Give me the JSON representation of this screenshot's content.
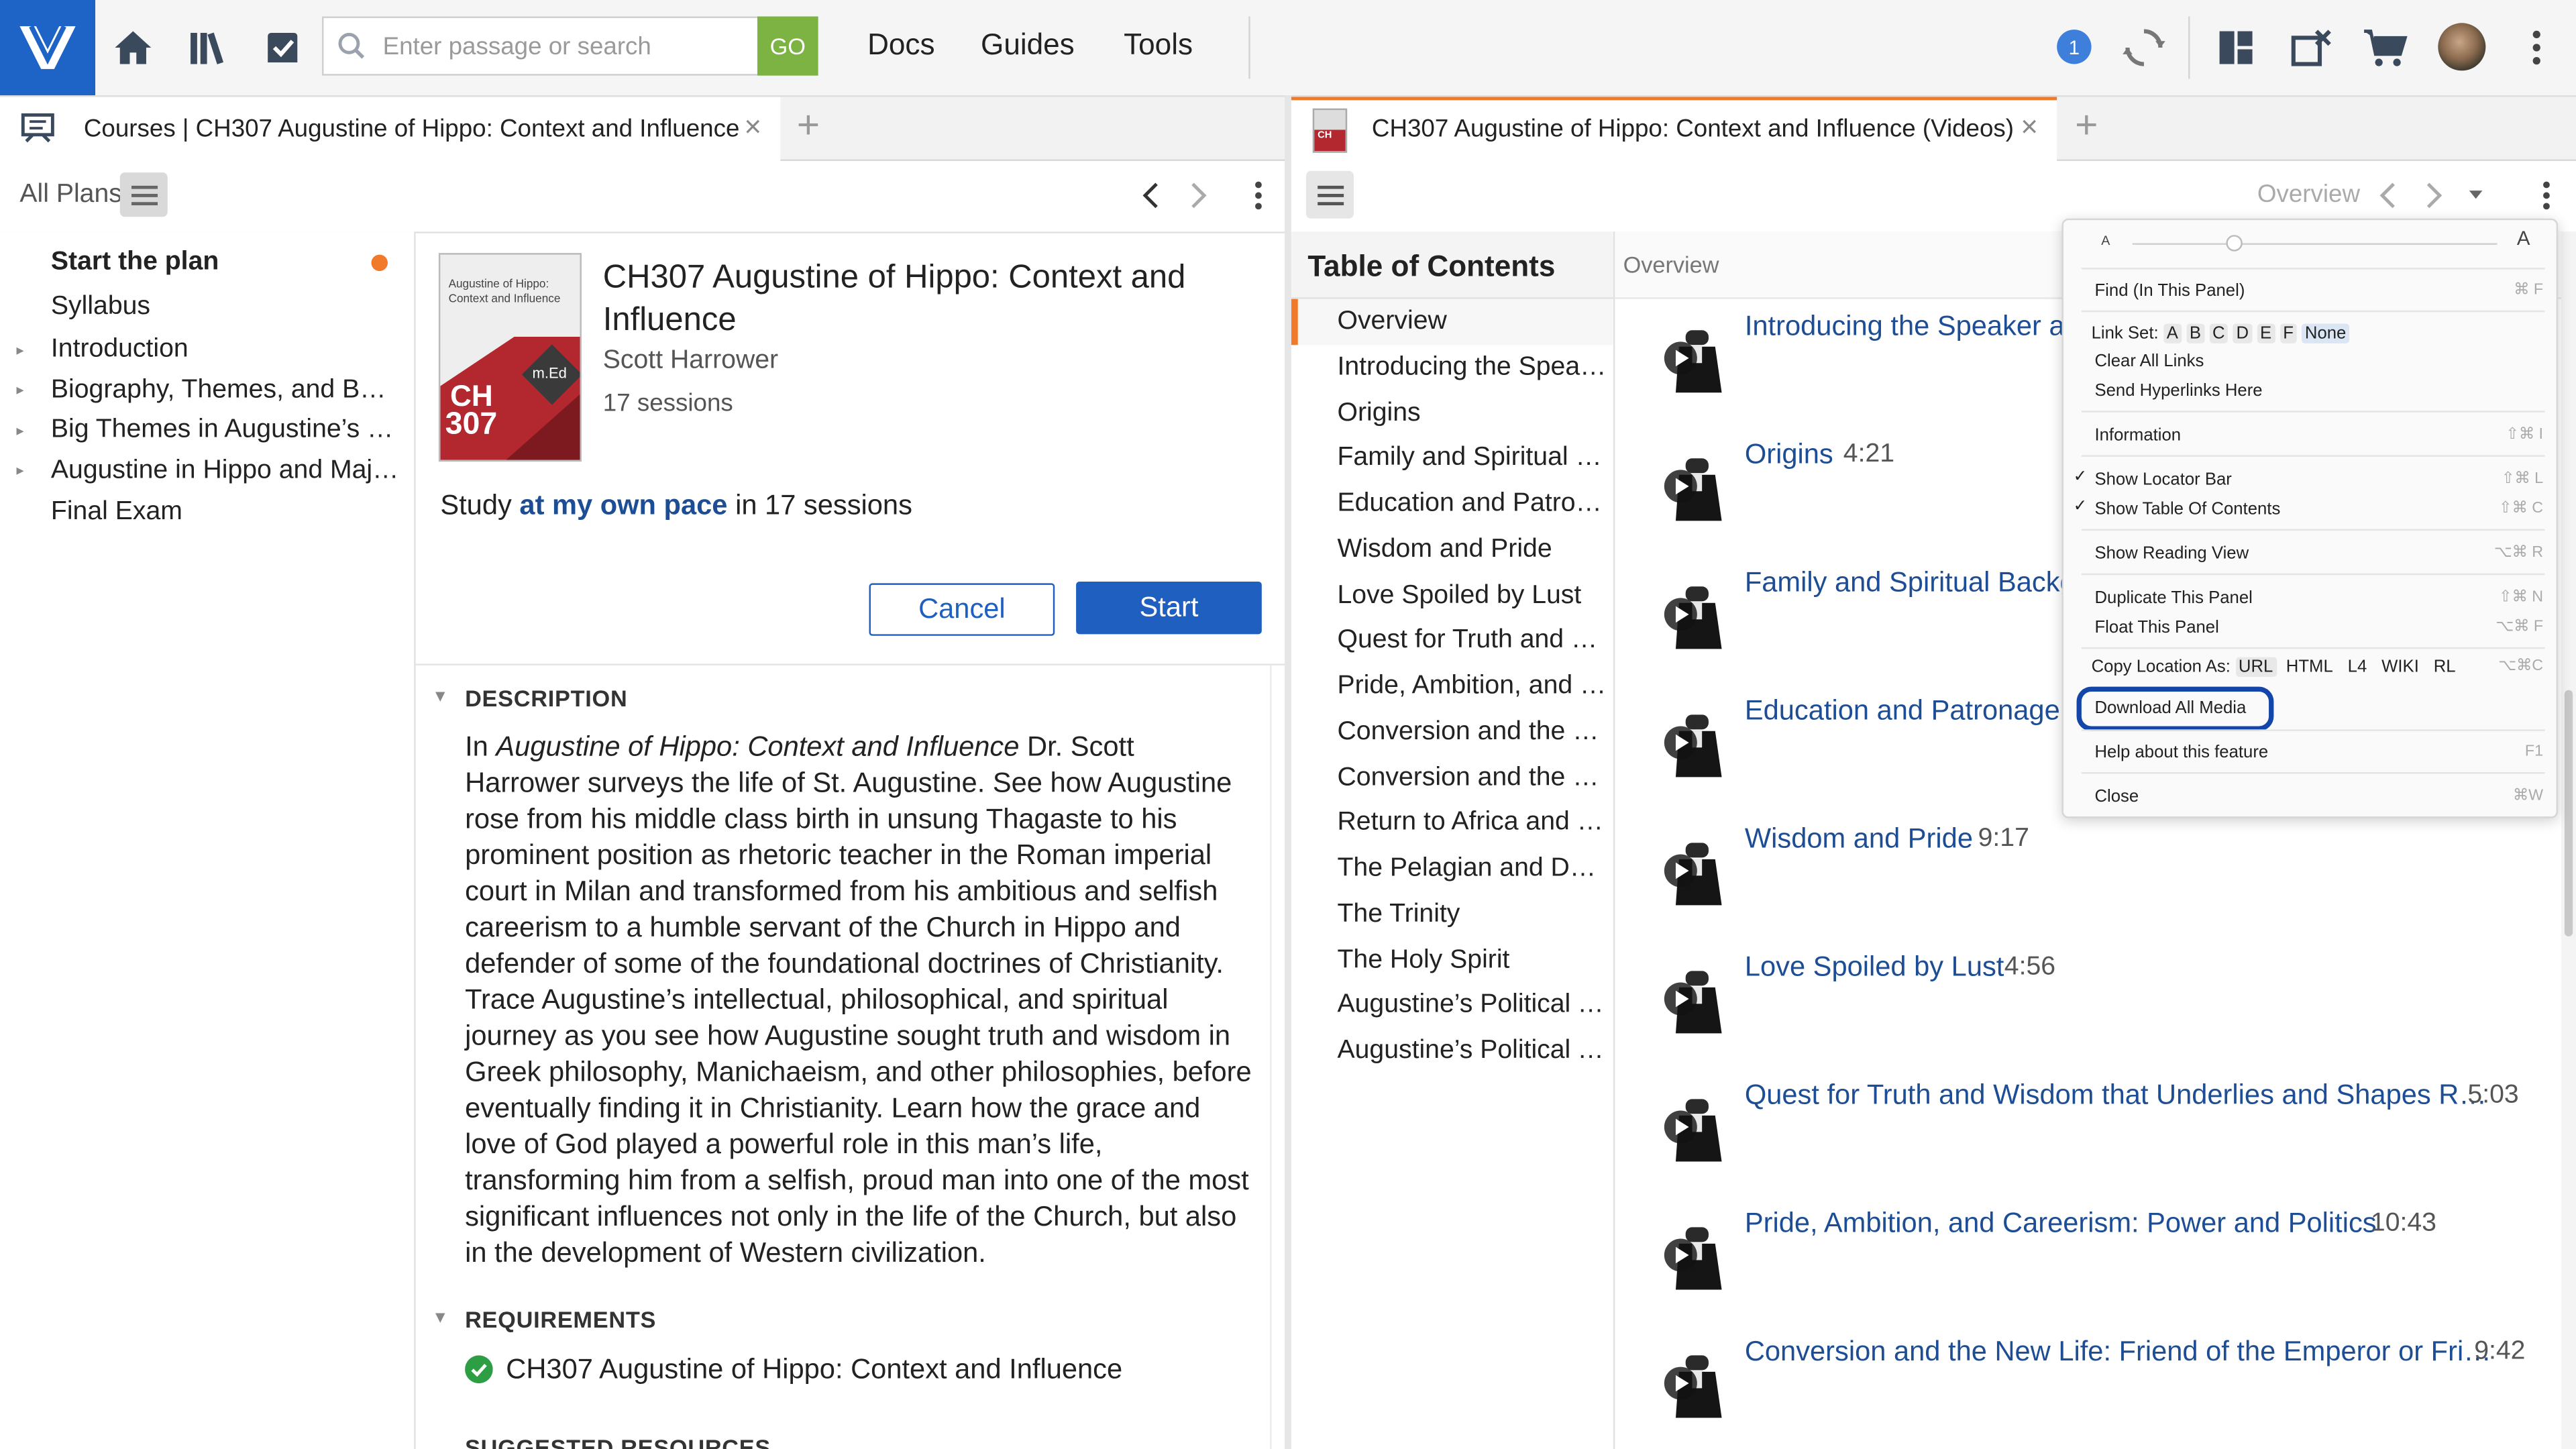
{
  "topbar": {
    "search_placeholder": "Enter passage or search",
    "go_label": "GO",
    "menu": [
      "Docs",
      "Guides",
      "Tools"
    ],
    "notification_count": "1"
  },
  "left_tab": {
    "title": "Courses | CH307 Augustine of Hippo: Context and Influence",
    "close": "×",
    "plus": "+"
  },
  "left_toolbar": {
    "all_plans": "All Plans"
  },
  "plan_sidebar": {
    "start": "Start the plan",
    "items": [
      "Syllabus",
      "Introduction",
      "Biography, Themes, and Background",
      "Big Themes in Augustine’s Life",
      "Augustine in Hippo and Major Works",
      "Final Exam"
    ],
    "carets": [
      "▸",
      "▸",
      "▸",
      "▸"
    ]
  },
  "course": {
    "title": "CH307 Augustine of Hippo: Context and Influence",
    "author": "Scott Harrower",
    "sessions": "17 sessions",
    "cover_caption": "Augustine of Hippo: Context and Influence",
    "cover_code_1": "CH",
    "cover_code_2": "307",
    "cover_badge": "m.Ed",
    "study_pre": "Study",
    "study_link": "at my own pace",
    "study_post": "in 17 sessions",
    "cancel": "Cancel",
    "start": "Start"
  },
  "description": {
    "heading": "DESCRIPTION",
    "pre": "In",
    "italic": "Augustine of Hippo: Context and Influence",
    "body": "Dr. Scott Harrower surveys the life of St. Augustine. See how Augustine rose from his middle class birth in unsung Thagaste to his prominent position as rhetoric teacher in the Roman imperial court in Milan and transformed from his ambitious and selfish careerism to a humble servant of the Church in Hippo and defender of some of the foundational doctrines of Christianity. Trace Augustine’s intellectual, philosophical, and spiritual journey as you see how Augustine sought truth and wisdom in Greek philosophy, Manichaeism, and other philosophies, before eventually finding it in Christianity. Learn how the grace and love of God played a powerful role in this man’s life, transforming him from a selfish, proud man into one of the most significant influences not only in the life of the Church, but also in the development of Western civilization."
  },
  "requirements": {
    "heading": "REQUIREMENTS",
    "item": "CH307 Augustine of Hippo: Context and Influence",
    "next_heading": "SUGGESTED RESOURCES"
  },
  "right_tab": {
    "title": "CH307 Augustine of Hippo: Context and Influence (Videos)",
    "close": "×",
    "plus": "+",
    "icon_code": "CH"
  },
  "right_toolbar": {
    "overview": "Overview"
  },
  "toc": {
    "heading": "Table of Contents",
    "items": [
      "Overview",
      "Introducing the Speaker and the Course",
      "Origins",
      "Family and Spiritual Background",
      "Education and Patronage",
      "Wisdom and Pride",
      "Love Spoiled by Lust",
      "Quest for Truth and Wisdom",
      "Pride, Ambition, and Careerism",
      "Conversion and the New Life",
      "Conversion and the New Life",
      "Return to Africa and the Church",
      "The Pelagian and Donatist Controversies",
      "The Trinity",
      "The Holy Spirit",
      "Augustine’s Political Theology",
      "Augustine’s Political Theology"
    ]
  },
  "content": {
    "breadcrumb": "Overview",
    "videos": [
      {
        "title": "Introducing the Speaker and the Course",
        "time": ""
      },
      {
        "title": "Origins",
        "time": "4:21"
      },
      {
        "title": "Family and Spiritual Background",
        "time": ""
      },
      {
        "title": "Education and Patronage",
        "time": ""
      },
      {
        "title": "Wisdom and Pride",
        "time": "9:17"
      },
      {
        "title": "Love Spoiled by Lust",
        "time": "4:56"
      },
      {
        "title": "Quest for Truth and Wisdom that Underlies and Shapes R…",
        "time": "5:03"
      },
      {
        "title": "Pride, Ambition, and Careerism: Power and Politics",
        "time": "10:43"
      },
      {
        "title": "Conversion and the New Life: Friend of the Emperor or Fri…",
        "time": "9:42"
      }
    ]
  },
  "panel_menu": {
    "font_small": "A",
    "font_large": "A",
    "find": "Find (In This Panel)",
    "find_sc": "⌘ F",
    "link_set_label": "Link Set:",
    "link_set_options": [
      "A",
      "B",
      "C",
      "D",
      "E",
      "F",
      "None"
    ],
    "clear_links": "Clear All Links",
    "send_links": "Send Hyperlinks Here",
    "information": "Information",
    "information_sc": "⇧⌘ I",
    "show_locator": "Show Locator Bar",
    "show_locator_sc": "⇧⌘ L",
    "show_toc": "Show Table Of Contents",
    "show_toc_sc": "⇧⌘ C",
    "check": "✓",
    "reading_view": "Show Reading View",
    "reading_view_sc": "⌥⌘ R",
    "duplicate": "Duplicate This Panel",
    "duplicate_sc": "⇧⌘ N",
    "float": "Float This Panel",
    "float_sc": "⌥⌘ F",
    "copy_location_label": "Copy Location As:",
    "copy_options": [
      "URL",
      "HTML",
      "L4",
      "WIKI",
      "RL"
    ],
    "copy_sc": "⌥⌘C",
    "download_all": "Download All Media",
    "help": "Help about this feature",
    "help_sc": "F1",
    "close": "Close",
    "close_sc": "⌘W"
  },
  "colors": {
    "brand_blue": "#1e63c6",
    "go_green": "#7cb342",
    "link_blue": "#1d4e95",
    "accent_orange": "#f07a2a",
    "check_green": "#2e9e44",
    "highlight_ring": "#1346a8"
  }
}
